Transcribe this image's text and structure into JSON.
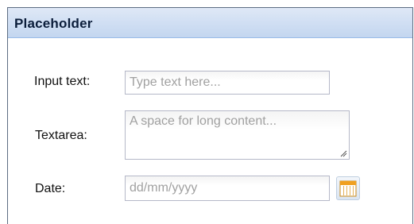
{
  "panel": {
    "title": "Placeholder"
  },
  "form": {
    "input_text": {
      "label": "Input text:",
      "value": "",
      "placeholder": "Type text here..."
    },
    "textarea": {
      "label": "Textarea:",
      "value": "",
      "placeholder": "A space for long content..."
    },
    "date": {
      "label": "Date:",
      "value": "",
      "placeholder": "dd/mm/yyyy",
      "picker_icon": "calendar-icon"
    }
  },
  "colors": {
    "header_gradient_top": "#dfe8f6",
    "header_gradient_bottom": "#c3d6ef",
    "panel_border": "#5d6d82",
    "field_border": "#b5b8c8",
    "placeholder_text": "#a0a0a0",
    "calendar_icon": "#f0a020"
  }
}
